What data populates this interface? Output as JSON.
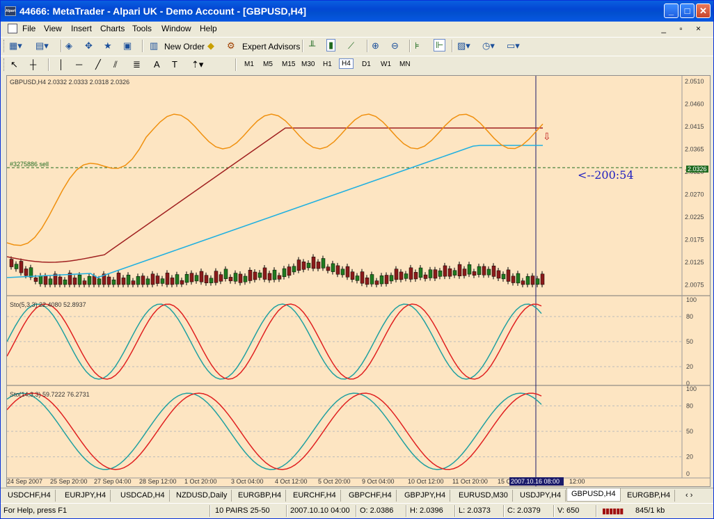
{
  "window": {
    "title": "44666: MetaTrader - Alpari UK - Demo Account - [GBPUSD,H4]",
    "app_icon_text": "Alpari"
  },
  "menu": [
    "File",
    "View",
    "Insert",
    "Charts",
    "Tools",
    "Window",
    "Help"
  ],
  "toolbar": {
    "new_order": "New Order",
    "expert_advisors": "Expert Advisors"
  },
  "timeframes": [
    "M1",
    "M5",
    "M15",
    "M30",
    "H1",
    "H4",
    "D1",
    "W1",
    "MN"
  ],
  "active_timeframe": "H4",
  "chart": {
    "main_label": "GBPUSD,H4  2.0332 2.0333 2.0318 2.0326",
    "order_label": "#3275886 sell",
    "annotation": "<--200:54",
    "current_price": "2.0326",
    "price_axis": [
      "2.0510",
      "2.0460",
      "2.0415",
      "2.0365",
      "2.0320",
      "2.0270",
      "2.0225",
      "2.0175",
      "2.0125",
      "2.0075"
    ],
    "sto1_label": "Sto(5,3,3) 22.4080 52.8937",
    "sto2_label": "Sto(14,3,3) 59.7222 76.2731",
    "sto_axis": [
      "100",
      "80",
      "50",
      "20",
      "0"
    ],
    "dates": [
      "24 Sep 2007",
      "25 Sep 20:00",
      "27 Sep 04:00",
      "28 Sep 12:00",
      "1 Oct 20:00",
      "3 Oct 04:00",
      "4 Oct 12:00",
      "5 Oct 20:00",
      "9 Oct 04:00",
      "10 Oct 12:00",
      "11 Oct 20:00",
      "15 Oct",
      "12:00"
    ],
    "crosshair_date": "2007.10.16 08:00",
    "colors": {
      "background": "#fde5c2",
      "bull": "#1f7a1f",
      "bear": "#8b1a1a",
      "ma_fast": "#f0900e",
      "ma_mid": "#a02020",
      "ma_slow": "#20b0e0",
      "sto_main": "#20a0a0",
      "sto_signal": "#e02020"
    }
  },
  "tabs": [
    "USDCHF,H4",
    "EURJPY,H4",
    "USDCAD,H4",
    "NZDUSD,Daily",
    "EURGBP,H4",
    "EURCHF,H4",
    "GBPCHF,H4",
    "GBPJPY,H4",
    "EURUSD,M30",
    "USDJPY,H4",
    "GBPUSD,H4",
    "EURGBP,H4"
  ],
  "active_tab": "GBPUSD,H4",
  "status": {
    "help": "For Help, press F1",
    "profile": "10 PAIRS 25-50",
    "datetime": "2007.10.10 04:00",
    "open": "O: 2.0386",
    "high": "H: 2.0396",
    "low": "L: 2.0373",
    "close": "C: 2.0379",
    "volume": "V: 650",
    "traffic": "845/1 kb"
  }
}
